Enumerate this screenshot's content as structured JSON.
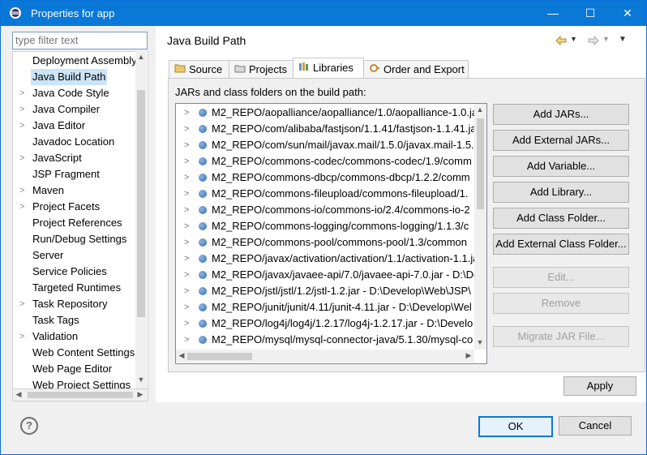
{
  "window": {
    "title": "Properties for app",
    "minimize_glyph": "—",
    "maximize_glyph": "☐",
    "close_glyph": "✕"
  },
  "left": {
    "filter_placeholder": "type filter text",
    "items": [
      {
        "label": "Deployment Assembly",
        "has_arrow": false
      },
      {
        "label": "Java Build Path",
        "has_arrow": false,
        "selected": true
      },
      {
        "label": "Java Code Style",
        "has_arrow": true
      },
      {
        "label": "Java Compiler",
        "has_arrow": true
      },
      {
        "label": "Java Editor",
        "has_arrow": true
      },
      {
        "label": "Javadoc Location",
        "has_arrow": false
      },
      {
        "label": "JavaScript",
        "has_arrow": true
      },
      {
        "label": "JSP Fragment",
        "has_arrow": false
      },
      {
        "label": "Maven",
        "has_arrow": true
      },
      {
        "label": "Project Facets",
        "has_arrow": true
      },
      {
        "label": "Project References",
        "has_arrow": false
      },
      {
        "label": "Run/Debug Settings",
        "has_arrow": false
      },
      {
        "label": "Server",
        "has_arrow": false
      },
      {
        "label": "Service Policies",
        "has_arrow": false
      },
      {
        "label": "Targeted Runtimes",
        "has_arrow": false
      },
      {
        "label": "Task Repository",
        "has_arrow": true
      },
      {
        "label": "Task Tags",
        "has_arrow": false
      },
      {
        "label": "Validation",
        "has_arrow": true
      },
      {
        "label": "Web Content Settings",
        "has_arrow": false
      },
      {
        "label": "Web Page Editor",
        "has_arrow": false
      },
      {
        "label": "Web Project Settings",
        "has_arrow": false
      }
    ]
  },
  "right": {
    "title": "Java Build Path",
    "tabs": [
      {
        "label": "Source",
        "icon": "source-folder-icon"
      },
      {
        "label": "Projects",
        "icon": "projects-icon"
      },
      {
        "label": "Libraries",
        "icon": "libraries-icon",
        "active": true
      },
      {
        "label": "Order and Export",
        "icon": "order-export-icon"
      }
    ],
    "panel_label": "JARs and class folders on the build path:",
    "jars": [
      "M2_REPO/aopalliance/aopalliance/1.0/aopalliance-1.0.ja",
      "M2_REPO/com/alibaba/fastjson/1.1.41/fastjson-1.1.41.ja",
      "M2_REPO/com/sun/mail/javax.mail/1.5.0/javax.mail-1.5.0",
      "M2_REPO/commons-codec/commons-codec/1.9/comm",
      "M2_REPO/commons-dbcp/commons-dbcp/1.2.2/comm",
      "M2_REPO/commons-fileupload/commons-fileupload/1.",
      "M2_REPO/commons-io/commons-io/2.4/commons-io-2",
      "M2_REPO/commons-logging/commons-logging/1.1.3/c",
      "M2_REPO/commons-pool/commons-pool/1.3/common",
      "M2_REPO/javax/activation/activation/1.1/activation-1.1.ja",
      "M2_REPO/javax/javaee-api/7.0/javaee-api-7.0.jar - D:\\De",
      "M2_REPO/jstl/jstl/1.2/jstl-1.2.jar - D:\\Develop\\Web\\JSP\\",
      "M2_REPO/junit/junit/4.11/junit-4.11.jar - D:\\Develop\\Wel",
      "M2_REPO/log4j/log4j/1.2.17/log4j-1.2.17.jar - D:\\Develo",
      "M2_REPO/mysql/mysql-connector-java/5.1.30/mysql-co"
    ],
    "buttons": {
      "add_jars": "Add JARs...",
      "add_external_jars": "Add External JARs...",
      "add_variable": "Add Variable...",
      "add_library": "Add Library...",
      "add_class_folder": "Add Class Folder...",
      "add_external_class_folder": "Add External Class Folder...",
      "edit": "Edit...",
      "remove": "Remove",
      "migrate_jar": "Migrate JAR File..."
    },
    "apply": "Apply"
  },
  "footer": {
    "help_glyph": "?",
    "ok": "OK",
    "cancel": "Cancel"
  },
  "colors": {
    "titlebar": "#0a78d7",
    "selection": "#cce4f7",
    "default_button_border": "#0a78d7"
  }
}
